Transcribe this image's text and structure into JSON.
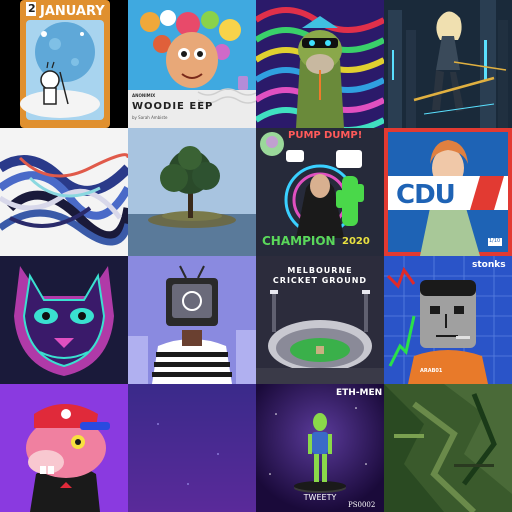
{
  "tiles": [
    {
      "name": "january-card",
      "text": {
        "number": "2",
        "title": "JANUARY"
      }
    },
    {
      "name": "woodie-ep-cover",
      "text": {
        "artist": "ANONIMIX",
        "title": "WOODIE EEP",
        "byline": "by Sarah Ambiste"
      }
    },
    {
      "name": "psychedelic-ape",
      "text": {}
    },
    {
      "name": "cyber-city-girl",
      "text": {}
    },
    {
      "name": "abstract-swirl",
      "text": {}
    },
    {
      "name": "tree-island",
      "text": {}
    },
    {
      "name": "pump-dump-champion",
      "text": {
        "pump": "PUMP",
        "dump": "DUMP!",
        "champion": "CHAMPION",
        "year": "2020"
      }
    },
    {
      "name": "cdu-poster",
      "text": {
        "logo": "CDU",
        "tag": "1/10"
      }
    },
    {
      "name": "neon-cat-face",
      "text": {}
    },
    {
      "name": "tv-head-character",
      "text": {}
    },
    {
      "name": "melbourne-cricket-ground",
      "text": {
        "line1": "MELBOURNE",
        "line2": "CRICKET GROUND"
      }
    },
    {
      "name": "stonks-man",
      "text": {
        "word": "stonks",
        "tag": "ARAB01"
      }
    },
    {
      "name": "pink-dino-cap",
      "text": {}
    },
    {
      "name": "purple-gradient",
      "text": {}
    },
    {
      "name": "ethmen-tweety",
      "text": {
        "top": "ETH-MEN",
        "name": "TWEETY",
        "code": "PS0002"
      }
    },
    {
      "name": "green-glitch",
      "text": {}
    }
  ],
  "colors": {
    "background": "#111111",
    "january_card": "#e0902f",
    "woodie_blue": "#3fa9e0",
    "cdu_blue": "#1e63b5",
    "cdu_red": "#e23a32",
    "stonks_blue": "#2a54c8",
    "purple_tile": "#4a2a8a",
    "tweety_space": "#2a1450",
    "glitch_green": "#3a5a2c"
  }
}
